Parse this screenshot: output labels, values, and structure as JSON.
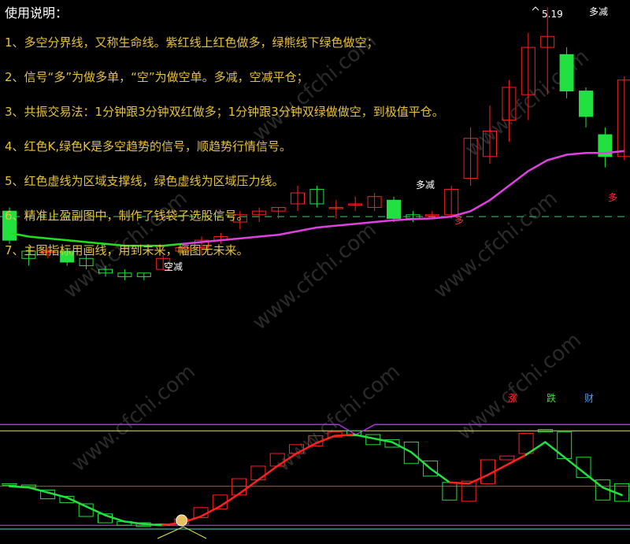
{
  "instructions": {
    "title": "使用说明：",
    "lines": [
      "1、多空分界线，又称生命线。紫红线上红色做多，绿熊线下绿色做空；",
      "2、信号“多”为做多单，“空”为做空单。多减，空减平仓；",
      "3、共振交易法：1分钟跟3分钟双红做多；1分钟跟3分钟双绿做做空，到极值平仓。",
      "4、红色K,绿色K是多空趋势的信号，顺趋势行情信号。",
      "5、红色虚线为区域支撑线，绿色虚线为区域压力线。",
      "6、精准止盈副图中，制作了钱袋子选股信号。",
      "7、主图指标用画线，用到未来，幅图无未来。"
    ]
  },
  "watermark": "www.cfchi.com",
  "colors": {
    "up": "#ff2020",
    "down": "#22e040",
    "life_line_up": "#e040e0",
    "life_line_down": "#20e020",
    "dashed_level": "#2ea85a",
    "sub_purple": "#b030e0",
    "sub_yellow": "#e8e840",
    "sub_red": "#ff3030",
    "sub_cyan": "#40e0e0"
  },
  "main_labels": {
    "high_price": "5.19",
    "duo_jian_top": "多减",
    "duo_jian_mid": "多减",
    "kong_jian": "空减",
    "duo_signal_1": "多",
    "duo_signal_2": "多"
  },
  "sub_legend": {
    "zhang": "涨",
    "die": "跌",
    "cai": "财"
  },
  "chart_data": [
    {
      "type": "candlestick",
      "title": "",
      "candles": [
        {
          "o": 4.63,
          "c": 4.55,
          "h": 4.64,
          "l": 4.54
        },
        {
          "o": 4.52,
          "c": 4.5,
          "h": 4.53,
          "l": 4.48
        },
        {
          "o": 4.52,
          "c": 4.52,
          "h": 4.53,
          "l": 4.5
        },
        {
          "o": 4.52,
          "c": 4.49,
          "h": 4.53,
          "l": 4.48
        },
        {
          "o": 4.5,
          "c": 4.48,
          "h": 4.51,
          "l": 4.47
        },
        {
          "o": 4.47,
          "c": 4.46,
          "h": 4.48,
          "l": 4.45
        },
        {
          "o": 4.46,
          "c": 4.45,
          "h": 4.47,
          "l": 4.44
        },
        {
          "o": 4.46,
          "c": 4.45,
          "h": 4.46,
          "l": 4.44
        },
        {
          "o": 4.47,
          "c": 4.5,
          "h": 4.51,
          "l": 4.47
        },
        {
          "o": 4.52,
          "c": 4.53,
          "h": 4.54,
          "l": 4.51
        },
        {
          "o": 4.53,
          "c": 4.55,
          "h": 4.56,
          "l": 4.51
        },
        {
          "o": 4.55,
          "c": 4.56,
          "h": 4.57,
          "l": 4.54
        },
        {
          "o": 4.6,
          "c": 4.62,
          "h": 4.63,
          "l": 4.58
        },
        {
          "o": 4.62,
          "c": 4.63,
          "h": 4.64,
          "l": 4.6
        },
        {
          "o": 4.63,
          "c": 4.64,
          "h": 4.64,
          "l": 4.61
        },
        {
          "o": 4.65,
          "c": 4.68,
          "h": 4.7,
          "l": 4.63
        },
        {
          "o": 4.69,
          "c": 4.65,
          "h": 4.7,
          "l": 4.64
        },
        {
          "o": 4.64,
          "c": 4.64,
          "h": 4.66,
          "l": 4.61
        },
        {
          "o": 4.65,
          "c": 4.65,
          "h": 4.67,
          "l": 4.63
        },
        {
          "o": 4.64,
          "c": 4.67,
          "h": 4.68,
          "l": 4.63
        },
        {
          "o": 4.66,
          "c": 4.61,
          "h": 4.67,
          "l": 4.6
        },
        {
          "o": 4.62,
          "c": 4.61,
          "h": 4.63,
          "l": 4.6
        },
        {
          "o": 4.62,
          "c": 4.62,
          "h": 4.63,
          "l": 4.61
        },
        {
          "o": 4.62,
          "c": 4.69,
          "h": 4.7,
          "l": 4.61
        },
        {
          "o": 4.72,
          "c": 4.83,
          "h": 4.86,
          "l": 4.7
        },
        {
          "o": 4.78,
          "c": 4.85,
          "h": 4.92,
          "l": 4.76
        },
        {
          "o": 4.88,
          "c": 4.97,
          "h": 4.99,
          "l": 4.82
        },
        {
          "o": 4.95,
          "c": 5.08,
          "h": 5.12,
          "l": 4.88
        },
        {
          "o": 5.08,
          "c": 5.11,
          "h": 5.19,
          "l": 4.95
        },
        {
          "o": 5.06,
          "c": 4.96,
          "h": 5.08,
          "l": 4.94
        },
        {
          "o": 4.96,
          "c": 4.89,
          "h": 4.97,
          "l": 4.86
        },
        {
          "o": 4.84,
          "c": 4.78,
          "h": 4.86,
          "l": 4.75
        },
        {
          "o": 4.78,
          "c": 4.99,
          "h": 5.0,
          "l": 4.77
        }
      ],
      "life_line": [
        4.57,
        4.56,
        4.555,
        4.55,
        4.545,
        4.54,
        4.535,
        4.535,
        4.535,
        4.54,
        4.545,
        4.55,
        4.555,
        4.56,
        4.565,
        4.575,
        4.585,
        4.59,
        4.595,
        4.6,
        4.605,
        4.608,
        4.61,
        4.615,
        4.63,
        4.66,
        4.7,
        4.74,
        4.77,
        4.785,
        4.79,
        4.79,
        4.795
      ],
      "life_line_split": 9,
      "dashed_level": 4.615,
      "y_range": [
        4.28,
        5.21
      ]
    },
    {
      "type": "oscillator",
      "title": "",
      "y_range": [
        0,
        100
      ],
      "levels": {
        "purple": 88,
        "yellow": 83,
        "red": 39,
        "magenta": 8,
        "cyan": 5
      },
      "boxes": [
        {
          "o": 41,
          "c": 40
        },
        {
          "o": 40,
          "c": 38
        },
        {
          "o": 36,
          "c": 29
        },
        {
          "o": 31,
          "c": 26
        },
        {
          "o": 25,
          "c": 15
        },
        {
          "o": 17,
          "c": 10
        },
        {
          "o": 11,
          "c": 8
        },
        {
          "o": 10,
          "c": 7
        },
        {
          "o": 9,
          "c": 8
        },
        {
          "o": 9,
          "c": 13
        },
        {
          "o": 14,
          "c": 22
        },
        {
          "o": 21,
          "c": 32
        },
        {
          "o": 32,
          "c": 45
        },
        {
          "o": 44,
          "c": 55
        },
        {
          "o": 55,
          "c": 65
        },
        {
          "o": 65,
          "c": 72
        },
        {
          "o": 71,
          "c": 79
        },
        {
          "o": 78,
          "c": 82
        },
        {
          "o": 83,
          "c": 79
        },
        {
          "o": 80,
          "c": 72
        },
        {
          "o": 76,
          "c": 70
        },
        {
          "o": 74,
          "c": 57
        },
        {
          "o": 59,
          "c": 47
        },
        {
          "o": 42,
          "c": 28
        },
        {
          "o": 27,
          "c": 43
        },
        {
          "o": 41,
          "c": 60
        },
        {
          "o": 60,
          "c": 63
        },
        {
          "o": 65,
          "c": 81
        },
        {
          "o": 84,
          "c": 82
        },
        {
          "o": 82,
          "c": 61
        },
        {
          "o": 62,
          "c": 46
        },
        {
          "o": 44,
          "c": 28
        },
        {
          "o": 41,
          "c": 27
        }
      ],
      "smooth": [
        39,
        38,
        34,
        30,
        23,
        16,
        11,
        9,
        8,
        10,
        15,
        23,
        33,
        44,
        55,
        65,
        73,
        79,
        80,
        77,
        74,
        66,
        53,
        42,
        41,
        48,
        56,
        64,
        74,
        62,
        50,
        38,
        32
      ],
      "smooth_colors": [
        "up",
        "down",
        "down",
        "down",
        "down",
        "down",
        "down",
        "down",
        "down",
        "up",
        "up",
        "up",
        "up",
        "up",
        "up",
        "up",
        "up",
        "up",
        "up",
        "down",
        "down",
        "down",
        "down",
        "down",
        "up",
        "up",
        "up",
        "up",
        "down",
        "down",
        "down",
        "down",
        "down"
      ],
      "signal_index": 9
    }
  ]
}
